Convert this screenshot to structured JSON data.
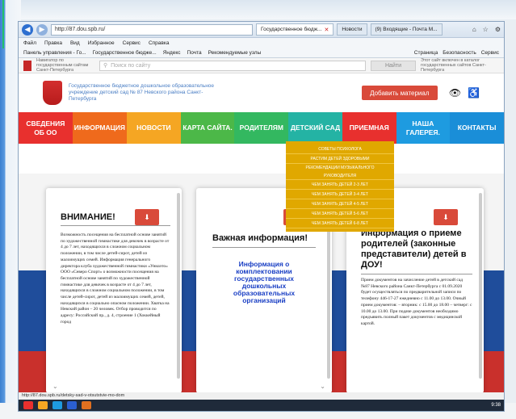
{
  "browser": {
    "url": "http://87.dou.spb.ru/",
    "tabs": [
      {
        "label": "Государственное бюдж...",
        "active": true
      },
      {
        "label": "Новости",
        "active": false
      },
      {
        "label": "(9) Входящие - Почта М...",
        "active": false
      }
    ],
    "menu": [
      "Файл",
      "Правка",
      "Вид",
      "Избранное",
      "Сервис",
      "Справка"
    ],
    "favorites": [
      "Панель управления - Го...",
      "Государственное бюдже...",
      "Яндекс",
      "Почта",
      "Рекомендуемые узлы"
    ],
    "toolbar_right": [
      "Страница",
      "Безопасность",
      "Сервис"
    ],
    "status_url": "http://87.dou.spb.ru/detsky-sad-v-otsutstvie-mo-dom"
  },
  "gov_bar": {
    "navigator": "Навигатор по государственным сайтам Санкт-Петербурга",
    "search_placeholder": "Поиск по сайту",
    "find_button": "Найти",
    "help_text": "Этот сайт включен в каталог государственных сайтов Санкт-Петербурга"
  },
  "header": {
    "title": "Государственное бюджетное дошкольное образовательное учреждение детский сад № 87 Невского района Санкт-Петербурга",
    "donate_button": "Добавить материал"
  },
  "nav": [
    {
      "label": "СВЕДЕНИЯ ОБ ОО",
      "color": "#e8302e"
    },
    {
      "label": "ИНФОРМАЦИЯ",
      "color": "#ef6a1c"
    },
    {
      "label": "НОВОСТИ",
      "color": "#f5a623"
    },
    {
      "label": "КАРТА САЙТА.",
      "color": "#4cb848"
    },
    {
      "label": "РОДИТЕЛЯМ",
      "color": "#33b860"
    },
    {
      "label": "ДЕТСКИЙ САД",
      "color": "#24b3a4"
    },
    {
      "label": "ПРИЕМНАЯ",
      "color": "#e8302e"
    },
    {
      "label": "НАША ГАЛЕРЕЯ.",
      "color": "#1e9be0"
    },
    {
      "label": "КОНТАКТЫ",
      "color": "#1a8ed8"
    }
  ],
  "dropdown": [
    "СОВЕТЫ ПСИХОЛОГА",
    "РАСТИМ ДЕТЕЙ ЗДОРОВЫМИ",
    "РЕКОМЕНДАЦИИ МУЗЫКАЛЬНОГО РУКОВОДИТЕЛЯ",
    "ЧЕМ ЗАНЯТЬ ДЕТЕЙ 2-3 ЛЕТ",
    "ЧЕМ ЗАНЯТЬ ДЕТЕЙ 3-4 ЛЕТ",
    "ЧЕМ ЗАНЯТЬ ДЕТЕЙ 4-5 ЛЕТ",
    "ЧЕМ ЗАНЯТЬ ДЕТЕЙ 5-6 ЛЕТ",
    "ЧЕМ ЗАНЯТЬ ДЕТЕЙ 6-8 ЛЕТ"
  ],
  "cards": {
    "attention": {
      "title": "ВНИМАНИЕ!",
      "body": "Возможность посещения на бесплатной основе занятий по художественной гимнастике для девочек в возрасте от 4 до 7 лет, находящихся в сложном социальном положении, в том числе детей-сирот, детей из малоимущих семей. Информация генерального директора клуба художественной гимнастики «Униаэто» ООО «Северо Спорт» о возможности посещения на бесплатной основе занятий по художественной гимнастике для девочек в возрасте от 4 до 7 лет, находящихся в сложном социальном положении, в том числе детей-сирот, детей из малоимущих семей, детей, находящихся в социально опасном положении. Хватка на Невский район – 20 человек. Отбор проводится по адресу: Российский пр., д. 4, строение 1 (Хоккейный город"
    },
    "important": {
      "title": "Важная информация!",
      "notice": "Информация о комплектовании государственных дошкольных образовательных организаций"
    },
    "reception": {
      "title": "Информация о приеме родителей (законные представители) детей в ДОУ!",
      "body": "Прием документов на зачисление детей в детский сад №87 Невского района Санкт-Петербурга с 01.09.2020 будет осуществляться по предварительной записи по телефону 446-17-27 ежедневно с 11.00 до 13.00. Очный прием документов: – вторник: с 15.00 до 18.00 – четверг: с 10.00 до 13.00. При подаче документов необходимо предъявить полный пакет документов с медицинской картой."
    }
  },
  "taskbar": {
    "time": "9:38"
  }
}
